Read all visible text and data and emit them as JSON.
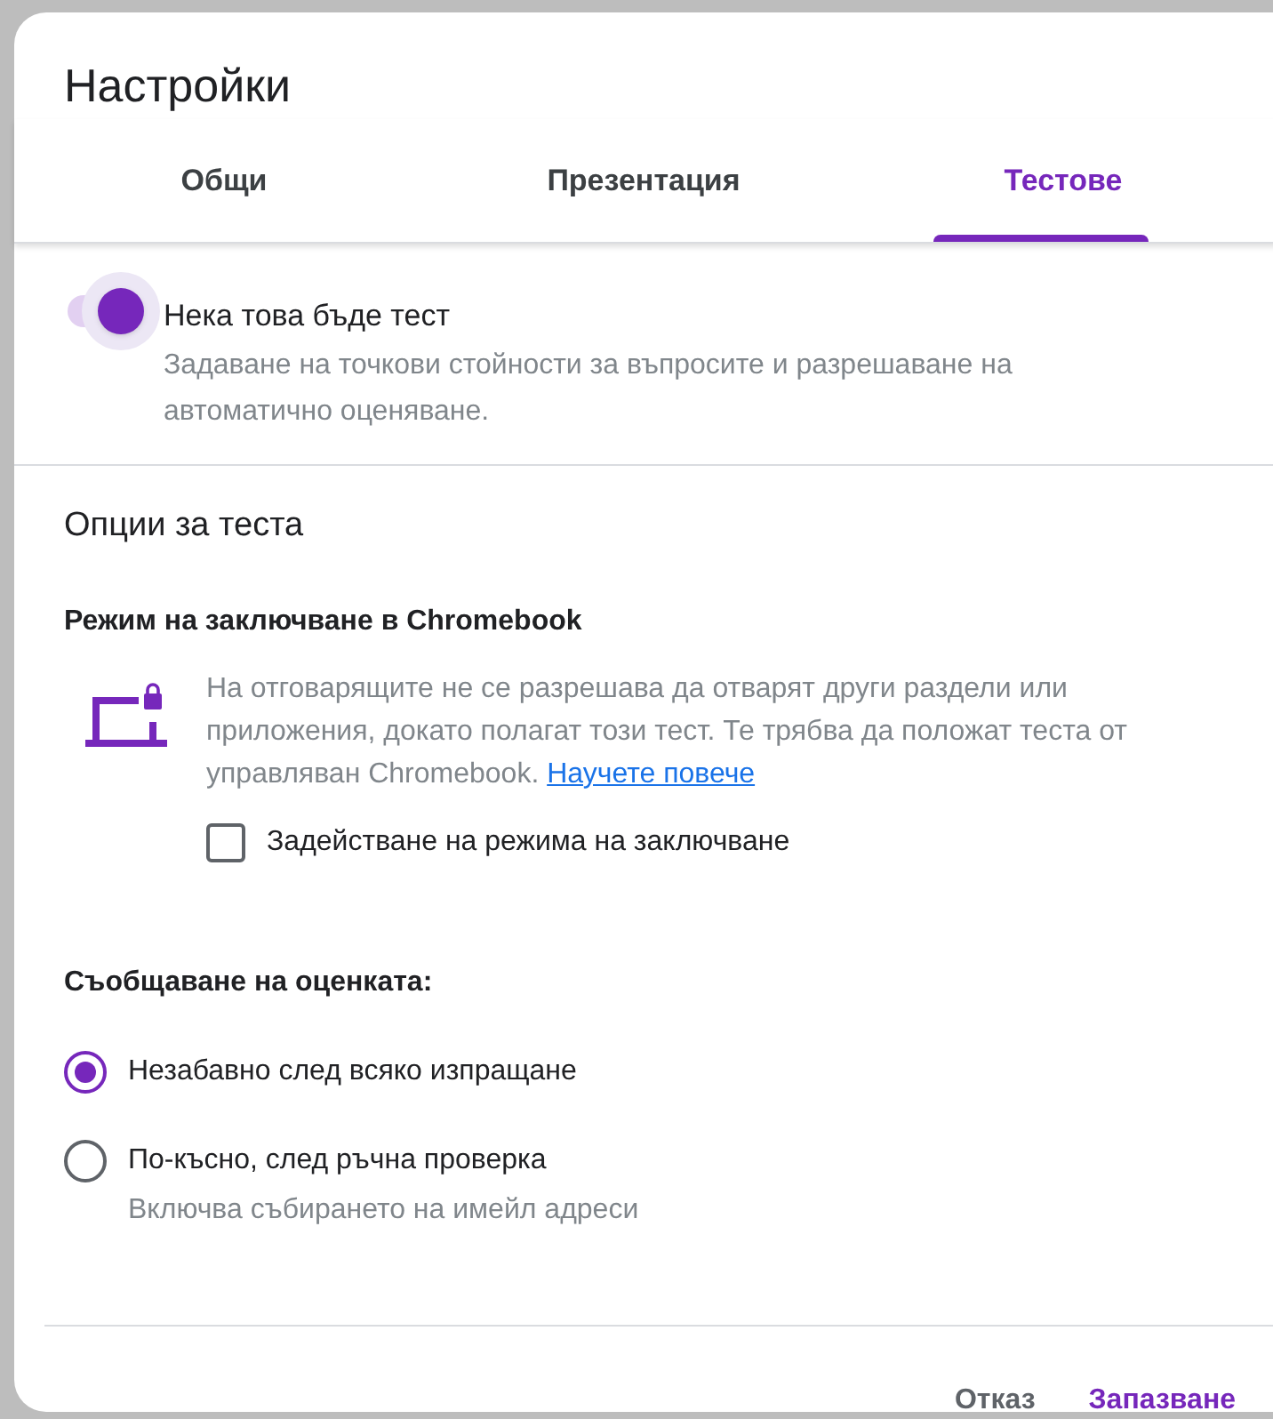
{
  "dialog": {
    "title": "Настройки"
  },
  "tabs": [
    {
      "label": "Общи",
      "selected": false
    },
    {
      "label": "Презентация",
      "selected": false
    },
    {
      "label": "Тестове",
      "selected": true
    }
  ],
  "quiz_toggle": {
    "label": "Нека това бъде тест",
    "description": "Задаване на точкови стойности за въпросите и разрешаване на автоматично оценяване.",
    "on": true
  },
  "options": {
    "heading": "Опции за теста",
    "lockdown": {
      "heading": "Режим на заключване в Chromebook",
      "description": "На отговарящите не се разрешава да отварят други раздели или приложения, докато полагат този тест. Те трябва да положат теста от управляван Chromebook.",
      "link": "Научете повече",
      "checkbox": {
        "label": "Задействане на режима на заключване",
        "checked": false
      }
    },
    "grade_release": {
      "heading": "Съобщаване на оценката:",
      "choices": [
        {
          "label": "Незабавно след всяко изпращане",
          "selected": true
        },
        {
          "label": "По-късно, след ръчна проверка",
          "hint": "Включва събирането на имейл адреси",
          "selected": false
        }
      ]
    }
  },
  "buttons": [
    {
      "label": "Отказ",
      "kind": "secondary"
    },
    {
      "label": "Запазване",
      "kind": "primary"
    }
  ]
}
